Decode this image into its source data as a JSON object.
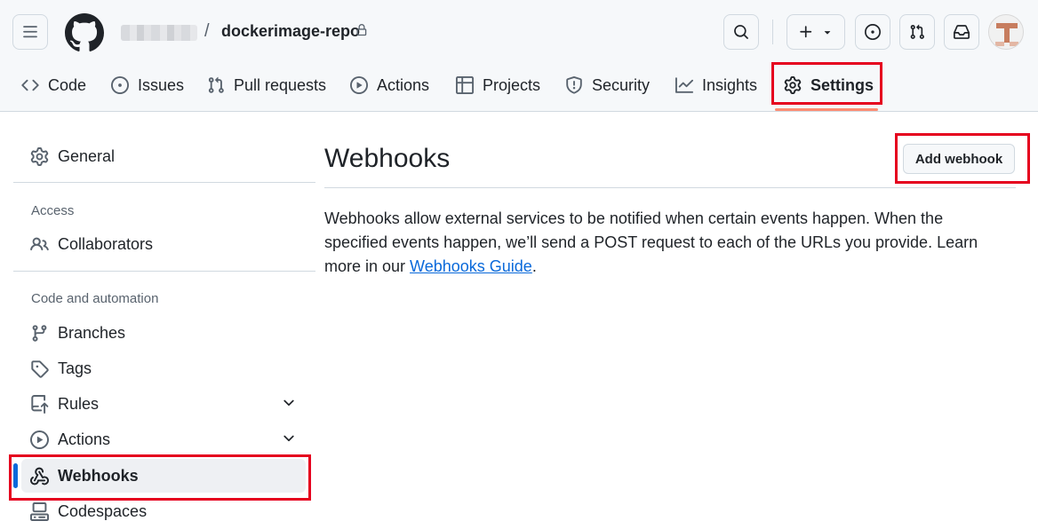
{
  "header": {
    "repo_separator": "/",
    "repo_name": "dockerimage-repo",
    "icons": [
      "hamburger-icon",
      "github-logo",
      "lock-icon",
      "search-icon",
      "plus-icon",
      "triangle-down-icon",
      "issue-opened-icon",
      "git-pull-request-icon",
      "inbox-icon",
      "avatar"
    ]
  },
  "tabs": [
    {
      "label": "Code",
      "icon": "code-icon"
    },
    {
      "label": "Issues",
      "icon": "issue-opened-icon"
    },
    {
      "label": "Pull requests",
      "icon": "git-pull-request-icon"
    },
    {
      "label": "Actions",
      "icon": "play-icon"
    },
    {
      "label": "Projects",
      "icon": "table-icon"
    },
    {
      "label": "Security",
      "icon": "shield-icon"
    },
    {
      "label": "Insights",
      "icon": "graph-icon"
    },
    {
      "label": "Settings",
      "icon": "gear-icon",
      "active": true
    }
  ],
  "sidebar": {
    "general": "General",
    "access_heading": "Access",
    "collaborators": "Collaborators",
    "code_automation_heading": "Code and automation",
    "items": [
      {
        "label": "Branches",
        "icon": "git-branch-icon"
      },
      {
        "label": "Tags",
        "icon": "tag-icon"
      },
      {
        "label": "Rules",
        "icon": "repo-push-icon",
        "expandable": true
      },
      {
        "label": "Actions",
        "icon": "play-icon",
        "expandable": true
      },
      {
        "label": "Webhooks",
        "icon": "webhook-icon",
        "active": true
      },
      {
        "label": "Codespaces",
        "icon": "codespaces-icon"
      }
    ]
  },
  "main": {
    "title": "Webhooks",
    "add_button": "Add webhook",
    "description_text": "Webhooks allow external services to be notified when certain events happen. When the specified events happen, we’ll send a POST request to each of the URLs you provide. Learn more in our ",
    "guide_link": "Webhooks Guide",
    "description_end": "."
  },
  "colors": {
    "accent": "#0969da",
    "tab_underline": "#fd8c73",
    "highlight_box": "#e5001e"
  }
}
